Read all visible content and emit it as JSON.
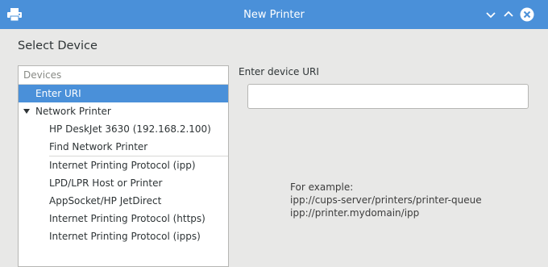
{
  "window": {
    "title": "New Printer",
    "accent_color": "#4a90d9"
  },
  "heading": "Select Device",
  "device_list": {
    "header": "Devices",
    "items": [
      {
        "label": "Enter URI",
        "level": 1,
        "selected": true
      },
      {
        "label": "Network Printer",
        "level": 1,
        "expanded": true
      },
      {
        "label": "HP DeskJet 3630 (192.168.2.100)",
        "level": 2
      },
      {
        "label": "Find Network Printer",
        "level": 2
      },
      {
        "label": "Internet Printing Protocol (ipp)",
        "level": 2
      },
      {
        "label": "LPD/LPR Host or Printer",
        "level": 2
      },
      {
        "label": "AppSocket/HP JetDirect",
        "level": 2
      },
      {
        "label": "Internet Printing Protocol (https)",
        "level": 2
      },
      {
        "label": "Internet Printing Protocol (ipps)",
        "level": 2
      }
    ]
  },
  "uri_panel": {
    "label": "Enter device URI",
    "value": "",
    "example_title": "For example:",
    "example_1": "ipp://cups-server/printers/printer-queue",
    "example_2": "ipp://printer.mydomain/ipp"
  },
  "icons": {
    "app": "printer-icon",
    "minimize": "chevron-down-icon",
    "maximize": "chevron-up-icon",
    "close": "close-icon"
  }
}
